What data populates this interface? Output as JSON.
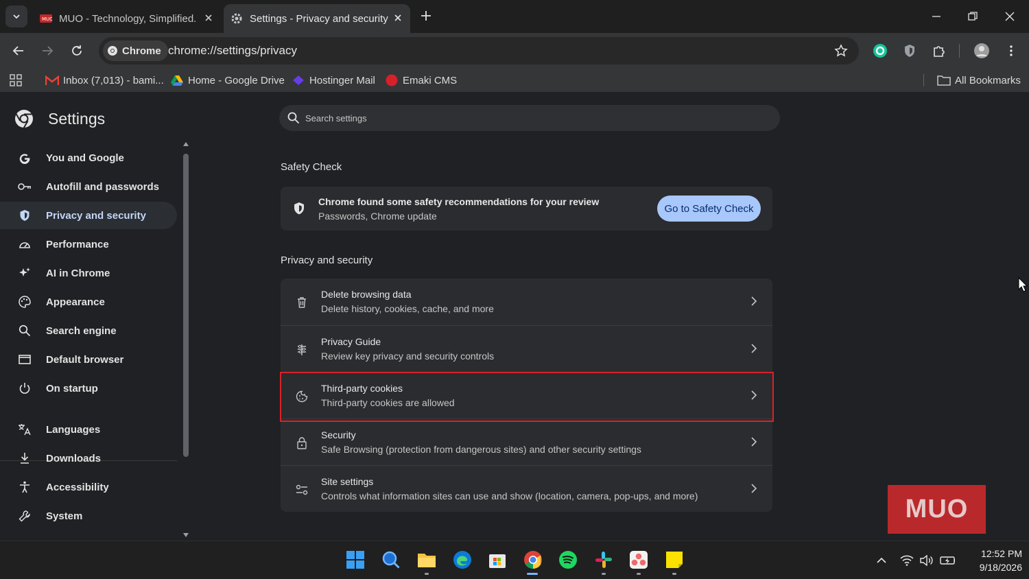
{
  "browser": {
    "tabs": [
      {
        "title": "MUO - Technology, Simplified.",
        "active": false
      },
      {
        "title": "Settings - Privacy and security",
        "active": true
      }
    ],
    "omnibox": {
      "chip_label": "Chrome",
      "url": "chrome://settings/privacy"
    },
    "bookmarks": [
      {
        "label": "Inbox (7,013) - bami...",
        "icon": "gmail-icon"
      },
      {
        "label": "Home - Google Drive",
        "icon": "google-drive-icon"
      },
      {
        "label": "Hostinger Mail",
        "icon": "hostinger-icon"
      },
      {
        "label": "Emaki CMS",
        "icon": "emaki-icon"
      }
    ],
    "all_bookmarks_label": "All Bookmarks"
  },
  "settings": {
    "title": "Settings",
    "search_placeholder": "Search settings",
    "nav": [
      {
        "label": "You and Google",
        "icon": "google-g-icon"
      },
      {
        "label": "Autofill and passwords",
        "icon": "key-icon"
      },
      {
        "label": "Privacy and security",
        "icon": "shield-icon",
        "active": true
      },
      {
        "label": "Performance",
        "icon": "speedometer-icon"
      },
      {
        "label": "AI in Chrome",
        "icon": "sparkle-icon"
      },
      {
        "label": "Appearance",
        "icon": "palette-icon"
      },
      {
        "label": "Search engine",
        "icon": "search-icon"
      },
      {
        "label": "Default browser",
        "icon": "browser-window-icon"
      },
      {
        "label": "On startup",
        "icon": "power-icon"
      },
      {
        "label": "Languages",
        "icon": "translate-icon"
      },
      {
        "label": "Downloads",
        "icon": "download-icon"
      },
      {
        "label": "Accessibility",
        "icon": "accessibility-icon"
      },
      {
        "label": "System",
        "icon": "wrench-icon"
      }
    ],
    "safety_check": {
      "heading": "Safety Check",
      "title": "Chrome found some safety recommendations for your review",
      "subtitle": "Passwords, Chrome update",
      "button": "Go to Safety Check"
    },
    "privacy": {
      "heading": "Privacy and security",
      "rows": [
        {
          "title": "Delete browsing data",
          "subtitle": "Delete history, cookies, cache, and more",
          "icon": "trash-icon"
        },
        {
          "title": "Privacy Guide",
          "subtitle": "Review key privacy and security controls",
          "icon": "privacy-guide-icon"
        },
        {
          "title": "Third-party cookies",
          "subtitle": "Third-party cookies are allowed",
          "icon": "cookie-icon",
          "highlighted": true
        },
        {
          "title": "Security",
          "subtitle": "Safe Browsing (protection from dangerous sites) and other security settings",
          "icon": "lock-icon"
        },
        {
          "title": "Site settings",
          "subtitle": "Controls what information sites can use and show (location, camera, pop-ups, and more)",
          "icon": "tune-icon"
        }
      ]
    }
  },
  "watermark": "MUO",
  "taskbar": {
    "apps": [
      "windows-start-icon",
      "search-icon",
      "file-explorer-icon",
      "edge-icon",
      "microsoft-store-icon",
      "chrome-icon",
      "spotify-icon",
      "slack-icon",
      "asana-icon",
      "sticky-notes-icon"
    ],
    "time": "12:52 PM",
    "date": "9/18/2026"
  },
  "colors": {
    "accent": "#a8c7fa",
    "highlight_border": "#d92228",
    "background": "#202124"
  }
}
